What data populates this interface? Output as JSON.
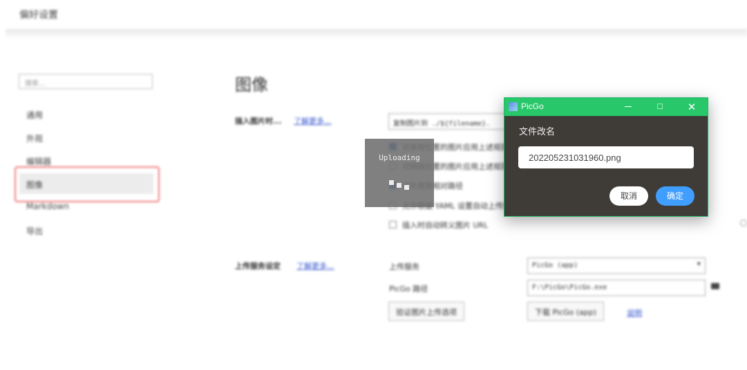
{
  "window": {
    "title": "偏好设置"
  },
  "sidebar": {
    "search_placeholder": "搜索...",
    "items": [
      {
        "label": "通用"
      },
      {
        "label": "外观"
      },
      {
        "label": "编辑器"
      },
      {
        "label": "图像"
      },
      {
        "label": "Markdown"
      },
      {
        "label": "导出"
      }
    ],
    "selected": "图像"
  },
  "main": {
    "title": "图像",
    "insert_section": {
      "label": "插入图片时...",
      "link": "了解更多...",
      "action_value": "复制图片到 ./${filename}.",
      "options": [
        {
          "label": "对本地位置的图片应用上述规则",
          "checked": true
        },
        {
          "label": "对网络位置的图片应用上述规则",
          "checked": false
        },
        {
          "label": "优先使用相对路径",
          "checked": true
        },
        {
          "label": "允许根据 YAML 设置自动上传图片",
          "checked": false
        },
        {
          "label": "插入时自动转义图片 URL",
          "checked": false
        }
      ]
    },
    "upload_section": {
      "label": "上传服务设定",
      "link": "了解更多...",
      "service_label": "上传服务",
      "service_value": "PicGo (app)",
      "path_label": "PicGo 路径",
      "path_value": "F:\\PicGo\\PicGo.exe",
      "verify_button": "验证图片上传选项",
      "download_button": "下载 PicGo (app)",
      "extra_link": "说明"
    }
  },
  "overlay": {
    "text": "Uploading"
  },
  "dialog": {
    "app_title": "PicGo",
    "label": "文件改名",
    "filename_value": "202205231031960.png",
    "cancel_label": "取消",
    "ok_label": "确定",
    "colors": {
      "titlebar": "#28c769",
      "body": "#3f3b37",
      "ok": "#409eff"
    }
  }
}
